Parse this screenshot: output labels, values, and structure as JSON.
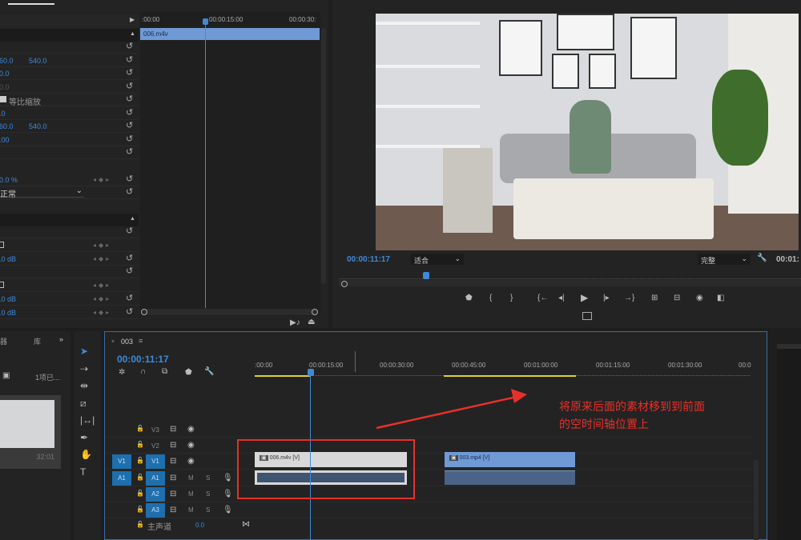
{
  "effect_controls": {
    "mini_ruler": [
      ":00:00",
      "00:00:15:00",
      "00:00:30:"
    ],
    "clip_name": "006.m4v",
    "rows": [
      {
        "value": "",
        "reset": true
      },
      {
        "value": "960.0",
        "value2": "540.0",
        "reset": true
      },
      {
        "value": "00.0",
        "reset": true
      },
      {
        "value": "00.0",
        "dim": true,
        "reset": true
      },
      {
        "value": "等比缩放",
        "checkbox": true,
        "reset": true
      },
      {
        "value": "0.0",
        "reset": true
      },
      {
        "value": "960.0",
        "value2": "540.0",
        "reset": true
      },
      {
        "value": "0.00",
        "reset": true
      },
      {
        "value": "",
        "reset": true
      }
    ],
    "opacity": "00.0 %",
    "blend_mode": "正常",
    "volume_rows": [
      "0.0 dB",
      "0.0 dB",
      "0.0 dB"
    ]
  },
  "program_monitor": {
    "timecode": "00:00:11:17",
    "fit": "适合",
    "quality": "完整",
    "duration": "00:01:",
    "controls": [
      "marker",
      "mark-in",
      "mark-out",
      "go-to-in",
      "step-back",
      "play",
      "step-forward",
      "go-to-out",
      "insert",
      "overwrite",
      "export-frame",
      "compare"
    ]
  },
  "project_panel": {
    "tab1": "器",
    "tab2": "库",
    "item_count": "1项已...",
    "duration": "32:01"
  },
  "tools": [
    "selection",
    "track-select",
    "ripple-edit",
    "razor",
    "slip",
    "pen",
    "hand",
    "type"
  ],
  "timeline": {
    "sequence": "003",
    "timecode": "00:00:11:17",
    "ruler": [
      ":00:00",
      "00:00:15:00",
      "00:00:30:00",
      "00:00:45:00",
      "00:01:00:00",
      "00:01:15:00",
      "00:01:30:00",
      "00:0"
    ],
    "video_tracks": [
      "V3",
      "V2",
      "V1"
    ],
    "audio_tracks": [
      "A1",
      "A2",
      "A3"
    ],
    "master_label": "主声道",
    "master_value": "0.0",
    "clips": [
      {
        "name": "006.m4v [V]",
        "track": "V1"
      },
      {
        "name": "003.mp4 [V]",
        "track": "V1"
      }
    ]
  },
  "annotation": {
    "line1": "将原来后面的素材移到到前面",
    "line2": "的空时间轴位置上",
    "color": "#e8302a"
  },
  "colors": {
    "accent": "#3e8ad8",
    "clip_video": "#6f9ad6",
    "clip_selected": "#d8d8d8",
    "track_patch": "#1d6fae"
  }
}
